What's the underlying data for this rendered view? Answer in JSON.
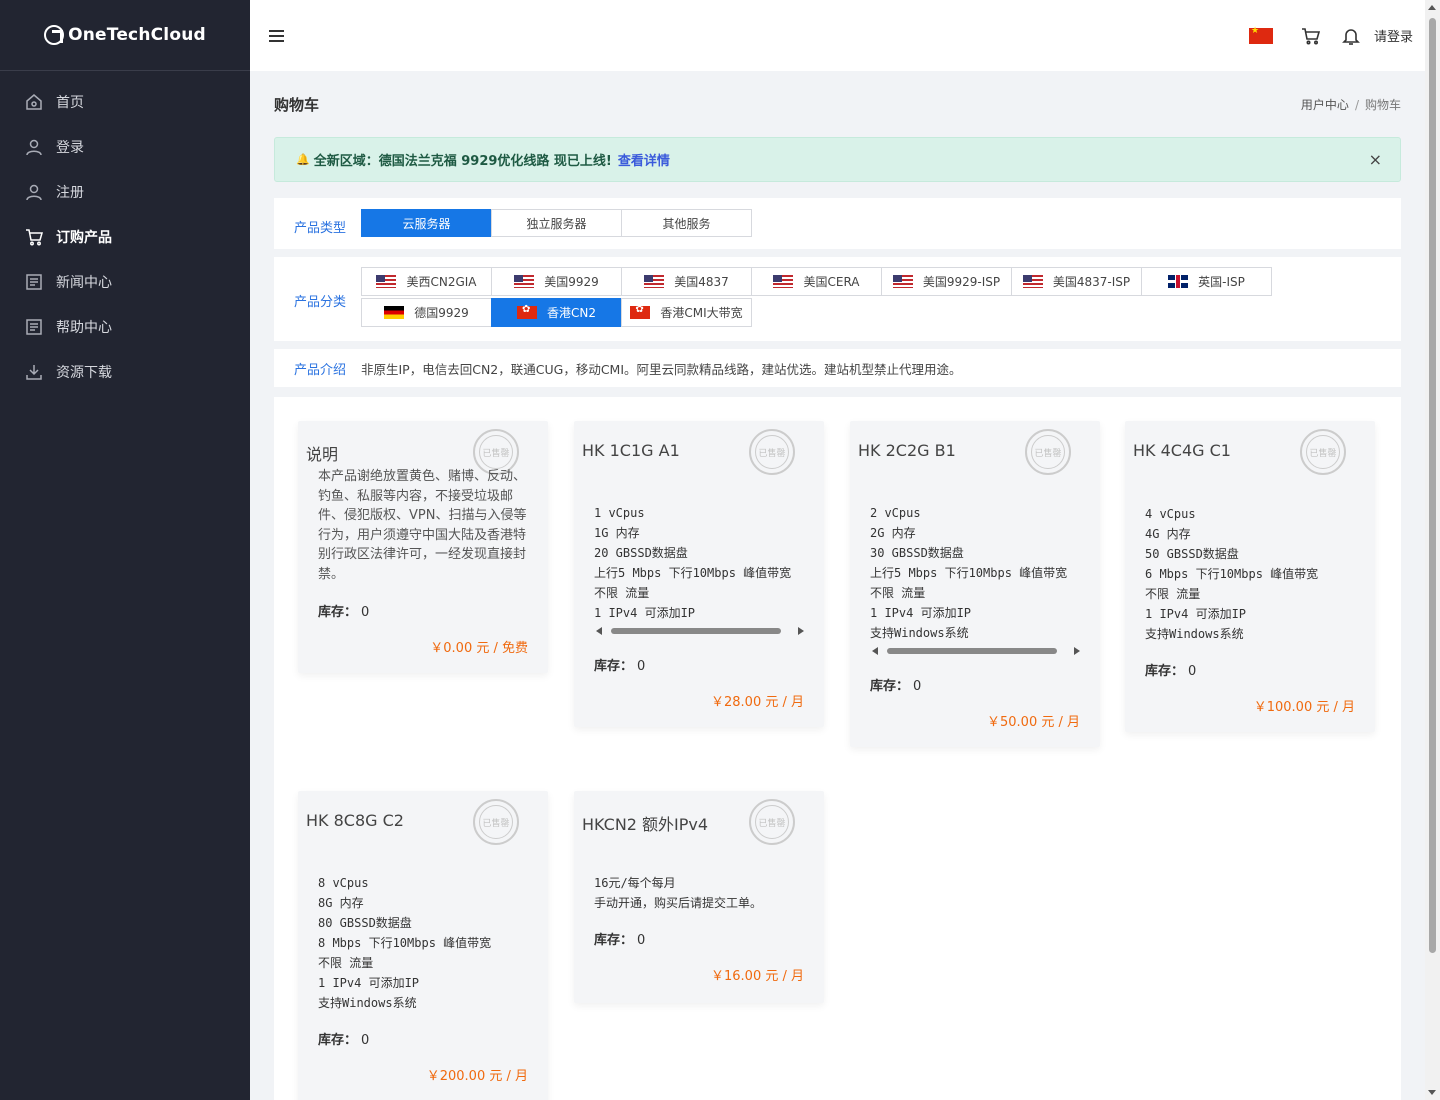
{
  "brand": {
    "name": "OneTechCloud"
  },
  "sidebar": {
    "items": [
      {
        "label": "首页",
        "icon": "home-icon"
      },
      {
        "label": "登录",
        "icon": "user-icon"
      },
      {
        "label": "注册",
        "icon": "user-add-icon"
      },
      {
        "label": "订购产品",
        "icon": "cart-icon",
        "active": true
      },
      {
        "label": "新闻中心",
        "icon": "news-icon"
      },
      {
        "label": "帮助中心",
        "icon": "help-icon"
      },
      {
        "label": "资源下载",
        "icon": "download-icon"
      }
    ]
  },
  "topbar": {
    "login_label": "请登录",
    "language_flag": "cn-flag-icon"
  },
  "page": {
    "title": "购物车",
    "breadcrumb": {
      "home": "用户中心",
      "sep": "/",
      "current": "购物车"
    }
  },
  "alert": {
    "text": "全新区域：德国法兰克福 9929优化线路 现已上线!",
    "link": "查看详情",
    "close": "×"
  },
  "filters": {
    "type_label": "产品类型",
    "types": [
      "云服务器",
      "独立服务器",
      "其他服务"
    ],
    "category_label": "产品分类",
    "categories": [
      {
        "label": "美西CN2GIA",
        "flag": "us"
      },
      {
        "label": "美国9929",
        "flag": "us"
      },
      {
        "label": "美国4837",
        "flag": "us"
      },
      {
        "label": "美国CERA",
        "flag": "us"
      },
      {
        "label": "美国9929-ISP",
        "flag": "us"
      },
      {
        "label": "美国4837-ISP",
        "flag": "us"
      },
      {
        "label": "英国-ISP",
        "flag": "gb"
      },
      {
        "label": "德国9929",
        "flag": "de"
      },
      {
        "label": "香港CN2",
        "flag": "hk"
      },
      {
        "label": "香港CMI大带宽",
        "flag": "hk"
      }
    ],
    "intro_label": "产品介绍",
    "intro_text": "非原生IP，电信去回CN2，联通CUG，移动CMI。阿里云同款精品线路，建站优选。建站机型禁止代理用途。"
  },
  "stamp_text": "已售罄",
  "stock_label": "库存：",
  "products": [
    {
      "title": "说明",
      "description": "本产品谢绝放置黄色、赌博、反动、钓鱼、私服等内容，不接受垃圾邮件、侵犯版权、VPN、扫描与入侵等行为，用户须遵守中国大陆及香港特别行政区法律许可，一经发现直接封禁。",
      "stock": "0",
      "price": "￥0.00 元 / 免费"
    },
    {
      "title": "HK 1C1G A1",
      "specs": "1 vCpus\n1G 内存\n20 GBSSD数据盘\n上行5 Mbps 下行10Mbps 峰值带宽\n不限 流量\n1 IPv4 可添加IP",
      "stock": "0",
      "price": "￥28.00 元 / 月"
    },
    {
      "title": "HK 2C2G B1",
      "specs": "2 vCpus\n2G 内存\n30 GBSSD数据盘\n上行5 Mbps 下行10Mbps 峰值带宽\n不限 流量\n1 IPv4 可添加IP\n支持Windows系统",
      "stock": "0",
      "price": "￥50.00 元 / 月"
    },
    {
      "title": "HK 4C4G C1",
      "specs": "4 vCpus\n4G 内存\n50 GBSSD数据盘\n6 Mbps 下行10Mbps 峰值带宽\n不限 流量\n1 IPv4 可添加IP\n支持Windows系统",
      "stock": "0",
      "price": "￥100.00 元 / 月"
    },
    {
      "title": "HK 8C8G C2",
      "specs": "8 vCpus\n8G 内存\n80 GBSSD数据盘\n8 Mbps 下行10Mbps 峰值带宽\n不限 流量\n1 IPv4 可添加IP\n支持Windows系统",
      "stock": "0",
      "price": "￥200.00 元 / 月"
    },
    {
      "title": "HKCN2 额外IPv4",
      "specs": "16元/每个每月\n手动开通，购买后请提交工单。",
      "stock": "0",
      "price": "￥16.00 元 / 月"
    }
  ]
}
